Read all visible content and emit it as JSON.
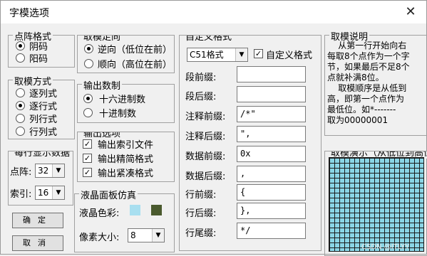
{
  "window": {
    "title": "字模选项"
  },
  "dot_format": {
    "title": "点阵格式",
    "options": [
      "阴码",
      "阳码"
    ],
    "selected": 0
  },
  "scan_mode": {
    "title": "取模方式",
    "options": [
      "逐列式",
      "逐行式",
      "列行式",
      "行列式"
    ],
    "selected": 1
  },
  "per_line": {
    "title": "每行显示数据",
    "dot_label": "点阵:",
    "dot_value": "32",
    "index_label": "索引:",
    "index_value": "16"
  },
  "buttons": {
    "ok": "确定",
    "cancel": "取消"
  },
  "scan_direction": {
    "title": "取模走向",
    "options": [
      "逆向（低位在前）",
      "顺向（高位在前）"
    ],
    "selected": 0
  },
  "output_radix": {
    "title": "输出数制",
    "options": [
      "十六进制数",
      "十进制数"
    ],
    "selected": 0
  },
  "output_options": {
    "title": "输出选项",
    "items": [
      {
        "label": "输出索引文件",
        "checked": true
      },
      {
        "label": "输出精简格式",
        "checked": true
      },
      {
        "label": "输出紧凑格式",
        "checked": true
      }
    ]
  },
  "lcd_sim": {
    "title": "液晶面板仿真",
    "color_label": "液晶色彩:",
    "pixel_label": "像素大小:",
    "pixel_value": "8",
    "colors": {
      "background": "#a8dff0",
      "foreground": "#4a5a2e"
    }
  },
  "custom_format": {
    "title": "自定义格式",
    "format_value": "C51格式",
    "custom_check_label": "自定义格式",
    "custom_checked": true,
    "fields": [
      {
        "label": "段前缀:",
        "value": ""
      },
      {
        "label": "段后缀:",
        "value": ""
      },
      {
        "label": "注释前缀:",
        "value": "/*\""
      },
      {
        "label": "注释后缀:",
        "value": "\","
      },
      {
        "label": "数据前缀:",
        "value": "0x"
      },
      {
        "label": "数据后缀:",
        "value": ","
      },
      {
        "label": "行前缀:",
        "value": "{"
      },
      {
        "label": "行后缀:",
        "value": "},"
      },
      {
        "label": "行尾缀:",
        "value": "*/"
      }
    ]
  },
  "scan_desc": {
    "title": "取模说明",
    "text": "    从第一行开始向右\n每取8个点作为一个字\n节，如果最后不足8个\n点就补满8位。\n    取模顺序是从低到\n高，即第一个点作为\n最低位。如*-------\n取为00000001"
  },
  "scan_demo": {
    "title": "取模演示（从低位到高位）"
  },
  "watermark": "CSDN @ITLYY"
}
